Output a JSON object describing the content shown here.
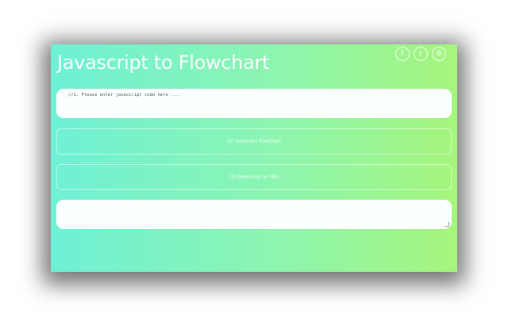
{
  "app": {
    "title": "Javascript to Flowchart"
  },
  "toolbar": {
    "buttons": [
      {
        "icon": "facebook-icon",
        "glyph": "f"
      },
      {
        "icon": "twitter-icon",
        "glyph": "t"
      },
      {
        "icon": "settings-icon",
        "glyph": "⚙"
      }
    ]
  },
  "editor": {
    "placeholder": "//1. Please enter javascript code here ..."
  },
  "actions": {
    "generate_label": "(2) Generate flowchart",
    "download_label": "(3) Download as PNG"
  },
  "output": {
    "value": ""
  }
}
